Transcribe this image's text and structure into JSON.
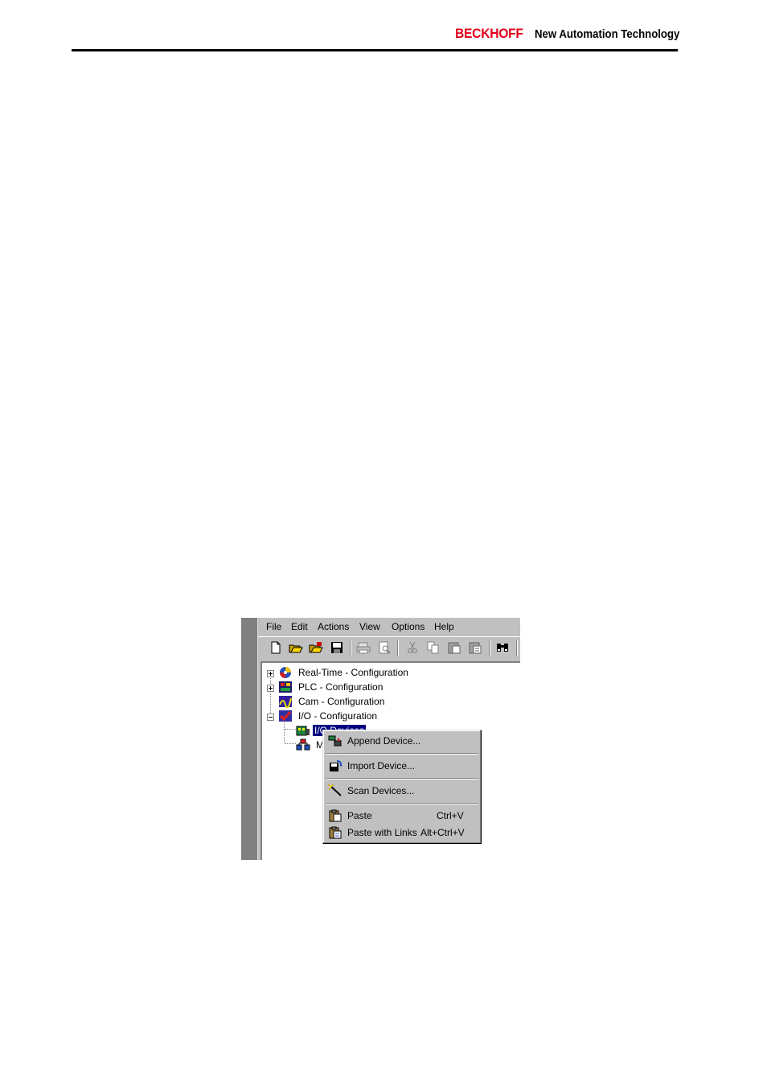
{
  "header": {
    "brand": "BECKHOFF",
    "tagline": "New Automation Technology"
  },
  "window": {
    "menu": [
      "File",
      "Edit",
      "Actions",
      "View",
      "Options",
      "Help"
    ],
    "tree": {
      "items": [
        {
          "label": "Real-Time - Configuration",
          "icon": "realtime-config-icon"
        },
        {
          "label": "PLC - Configuration",
          "icon": "plc-config-icon"
        },
        {
          "label": "Cam - Configuration",
          "icon": "cam-config-icon"
        },
        {
          "label": "I/O - Configuration",
          "icon": "io-config-icon"
        },
        {
          "label": "I/O Devices",
          "icon": "io-devices-icon"
        },
        {
          "label": "M",
          "icon": "mappings-icon"
        }
      ]
    },
    "context_menu": {
      "items": [
        {
          "label": "Append Device...",
          "shortcut": "",
          "icon": "append-device-icon"
        },
        {
          "label": "Import Device...",
          "shortcut": "",
          "icon": "import-device-icon"
        },
        {
          "label": "Scan Devices...",
          "shortcut": "",
          "icon": "scan-devices-icon"
        },
        {
          "label": "Paste",
          "shortcut": "Ctrl+V",
          "icon": "paste-icon"
        },
        {
          "label": "Paste with Links",
          "shortcut": "Alt+Ctrl+V",
          "icon": "paste-links-icon"
        }
      ]
    }
  }
}
